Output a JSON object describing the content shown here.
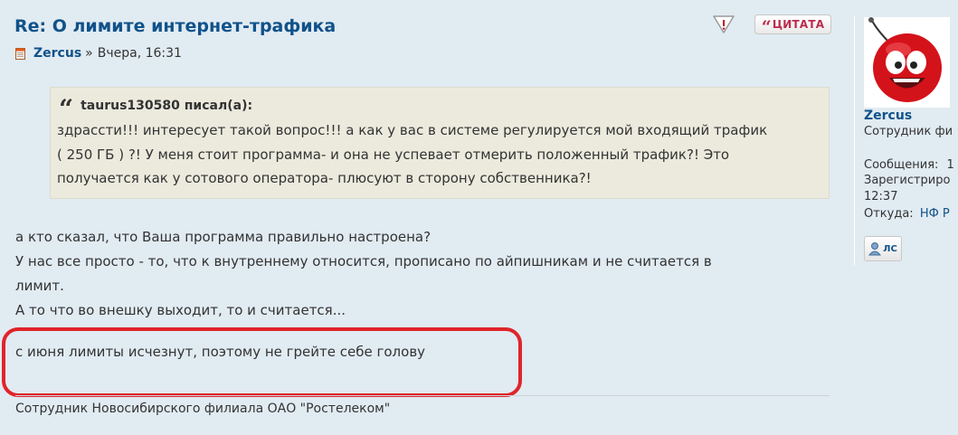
{
  "post": {
    "title": "Re: О лимите интернет-трафика",
    "author": "Zercus",
    "separator": "»",
    "date": "Вчера, 16:31",
    "buttons": {
      "report_icon": "report-warning-icon",
      "quote_label": "ЦИТАТА",
      "quote_mark": "“"
    },
    "quote": {
      "mark": "“",
      "header": "taurus130580 писал(а):",
      "lines": [
        "здрассти!!! интересует такой вопрос!!! а как у вас в системе регулируется мой входящий трафик",
        "( 250 ГБ ) ?! У меня стоит программа- и она не успевает отмерить положенный трафик?! Это",
        "получается как у сотового оператора- плюсуют в сторону собственника?!"
      ]
    },
    "body_lines": [
      "а кто сказал, что Ваша программа правильно настроена?",
      "У нас все просто - то, что к внутреннему относится, прописано по айпишникам и не считается в",
      "лимит.",
      "А то что во внешку выходит, то и считается...",
      "с июня лимиты исчезнут, поэтому не грейте себе голову"
    ],
    "signature": "Сотрудник Новосибирского филиала ОАО \"Ростелеком\""
  },
  "profile": {
    "name": "Zercus",
    "rank": "Сотрудник фи",
    "messages_label": "Сообщения:",
    "messages_value": "1",
    "registered_label": "Зарегистриро",
    "registered_time": "12:37",
    "from_label": "Откуда:",
    "from_value": "НФ Р",
    "pm_label": "ЛС"
  },
  "colors": {
    "accent": "#105289",
    "highlight_outline": "#e0242a",
    "quote_bg": "#ebeadd",
    "page_bg": "#e1ebf2"
  }
}
